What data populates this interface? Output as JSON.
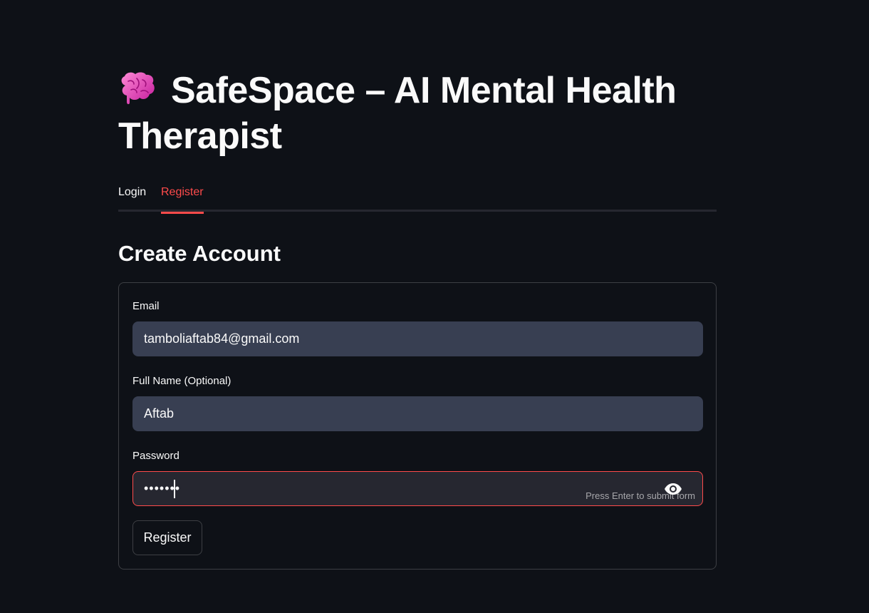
{
  "app": {
    "title": "SafeSpace – AI Mental Health Therapist",
    "icon": "brain-icon",
    "accent_color": "#ff4b4b",
    "background_color": "#0e1117"
  },
  "tabs": [
    {
      "label": "Login",
      "active": false
    },
    {
      "label": "Register",
      "active": true
    }
  ],
  "form": {
    "heading": "Create Account",
    "fields": [
      {
        "label": "Email",
        "value": "tamboliaftab84@gmail.com",
        "type": "text"
      },
      {
        "label": "Full Name (Optional)",
        "value": "Aftab",
        "type": "text"
      },
      {
        "label": "Password",
        "value": "•••••••",
        "type": "password",
        "focused": true,
        "toggle_icon": "eye-icon",
        "hint": "Press Enter to submit form"
      }
    ],
    "submit_label": "Register"
  }
}
